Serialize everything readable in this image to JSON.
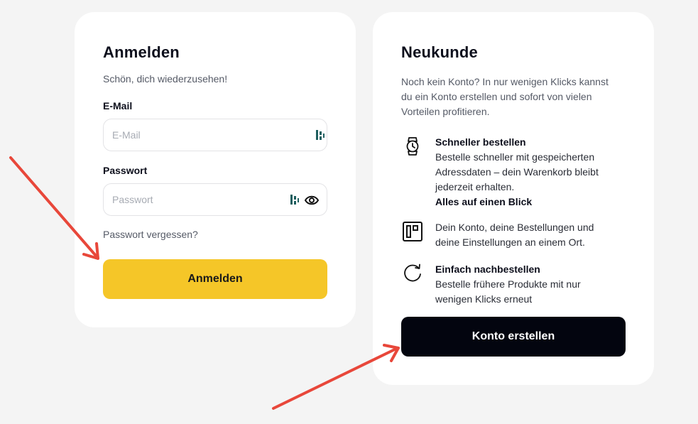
{
  "login": {
    "title": "Anmelden",
    "subtitle": "Schön, dich wiederzusehen!",
    "email_label": "E-Mail",
    "email_placeholder": "E-Mail",
    "email_value": "",
    "password_label": "Passwort",
    "password_placeholder": "Passwort",
    "password_value": "",
    "forgot_label": "Passwort vergessen?",
    "submit_label": "Anmelden"
  },
  "register": {
    "title": "Neukunde",
    "intro": "Noch kein Konto? In nur wenigen Klicks kannst du ein Konto erstellen und sofort von vielen Vorteilen profitieren.",
    "benefits": [
      {
        "icon": "watch-icon",
        "heading": "Schneller bestellen",
        "body": "Bestelle schneller mit gespeicherten Adressdaten – dein Warenkorb bleibt jederzeit erhalten."
      },
      {
        "icon": "dashboard-icon",
        "heading": "Alles auf einen Blick",
        "body": "Dein Konto, deine Bestellungen und deine Einstellungen an einem Ort."
      },
      {
        "icon": "refresh-icon",
        "heading": "Einfach nachbestellen",
        "body": "Bestelle frühere Produkte mit nur wenigen Klicks erneut"
      }
    ],
    "submit_label": "Konto erstellen"
  },
  "colors": {
    "page_background": "#f4f4f4",
    "card_background": "#ffffff",
    "login_button": "#f5c628",
    "register_button": "#03050f",
    "password_manager_icon": "#1f5f5f",
    "annotation_arrow": "#e8473a"
  }
}
